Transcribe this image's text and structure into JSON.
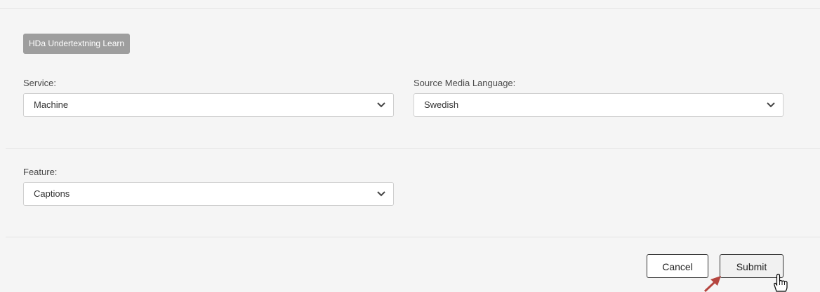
{
  "header": {
    "tag_label": "HDa Undertextning Learn"
  },
  "form": {
    "service": {
      "label": "Service:",
      "value": "Machine"
    },
    "source_language": {
      "label": "Source Media Language:",
      "value": "Swedish"
    },
    "feature": {
      "label": "Feature:",
      "value": "Captions"
    }
  },
  "footer": {
    "cancel_label": "Cancel",
    "submit_label": "Submit"
  },
  "colors": {
    "arrow": "#b5453f",
    "tag_bg": "#9e9e9e",
    "background": "#f5f5f5"
  }
}
